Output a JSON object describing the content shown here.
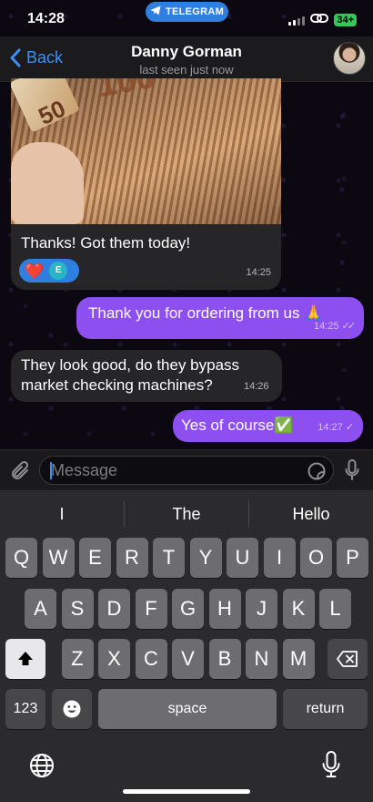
{
  "status_bar": {
    "time": "14:28",
    "app_pill": "TELEGRAM",
    "battery": "34+",
    "battery_color": "#35c759"
  },
  "header": {
    "back_label": "Back",
    "title": "Danny Gorman",
    "subtitle": "last seen just now"
  },
  "messages": [
    {
      "direction": "incoming",
      "has_photo": true,
      "text": "Thanks! Got them today!",
      "reactions": {
        "emoji": "❤️",
        "avatar_letter": "E"
      },
      "time": "14:25"
    },
    {
      "direction": "outgoing",
      "text": "Thank you for ordering from us 🙏",
      "time": "14:25",
      "status": "read"
    },
    {
      "direction": "incoming",
      "text_line1": "They look good, do they bypass",
      "text_line2": "market checking machines?",
      "time": "14:26"
    },
    {
      "direction": "outgoing",
      "text": "Yes of course",
      "emoji": "✅",
      "time": "14:27",
      "status": "sent"
    }
  ],
  "composer": {
    "placeholder": "Message"
  },
  "keyboard": {
    "suggestions": [
      "I",
      "The",
      "Hello"
    ],
    "row1": [
      "Q",
      "W",
      "E",
      "R",
      "T",
      "Y",
      "U",
      "I",
      "O",
      "P"
    ],
    "row2": [
      "A",
      "S",
      "D",
      "F",
      "G",
      "H",
      "J",
      "K",
      "L"
    ],
    "row3": [
      "Z",
      "X",
      "C",
      "V",
      "B",
      "N",
      "M"
    ],
    "numbers_key": "123",
    "space_key": "space",
    "return_key": "return"
  },
  "colors": {
    "accent": "#3e8ef7",
    "outgoing_bubble": "#8e4ff0",
    "incoming_bubble": "#262628",
    "telegram_blue": "#2f7fe0"
  }
}
